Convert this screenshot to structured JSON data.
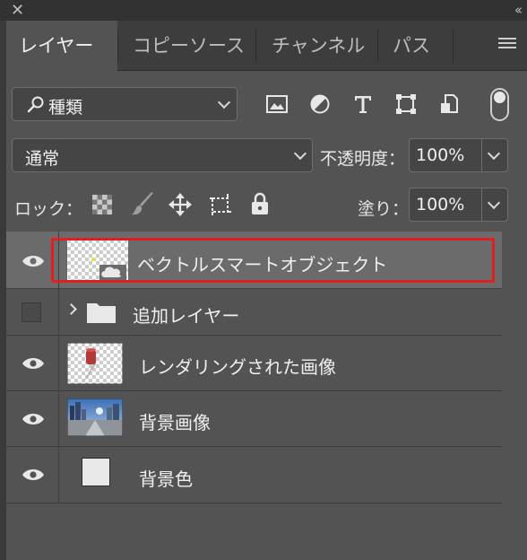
{
  "window": {
    "close_glyph": "✕",
    "collapse_glyph": "‹‹"
  },
  "tabs": [
    {
      "label": "レイヤー",
      "active": true
    },
    {
      "label": "コピーソース",
      "active": false
    },
    {
      "label": "チャンネル",
      "active": false
    },
    {
      "label": "パス",
      "active": false
    }
  ],
  "filter": {
    "kind_label": "種類",
    "icons": [
      "image-filter-icon",
      "adjustment-filter-icon",
      "type-filter-icon",
      "shape-filter-icon",
      "smart-object-filter-icon"
    ]
  },
  "blend": {
    "mode": "通常",
    "opacity_label": "不透明度：",
    "opacity_value": "100%"
  },
  "lock": {
    "label": "ロック：",
    "fill_label": "塗り：",
    "fill_value": "100%"
  },
  "layers": [
    {
      "name": "ベクトルスマートオブジェクト",
      "visible": true,
      "selected": true,
      "type": "smart-object"
    },
    {
      "name": "追加レイヤー",
      "visible": false,
      "selected": false,
      "type": "group"
    },
    {
      "name": "レンダリングされた画像",
      "visible": true,
      "selected": false,
      "type": "pixel"
    },
    {
      "name": "背景画像",
      "visible": true,
      "selected": false,
      "type": "photo"
    },
    {
      "name": "背景色",
      "visible": true,
      "selected": false,
      "type": "solid"
    }
  ],
  "colors": {
    "panel": "#535353",
    "tabbar": "#3d3d3d",
    "selected_row": "#6b6b6b",
    "highlight_outline": "#e02020"
  }
}
